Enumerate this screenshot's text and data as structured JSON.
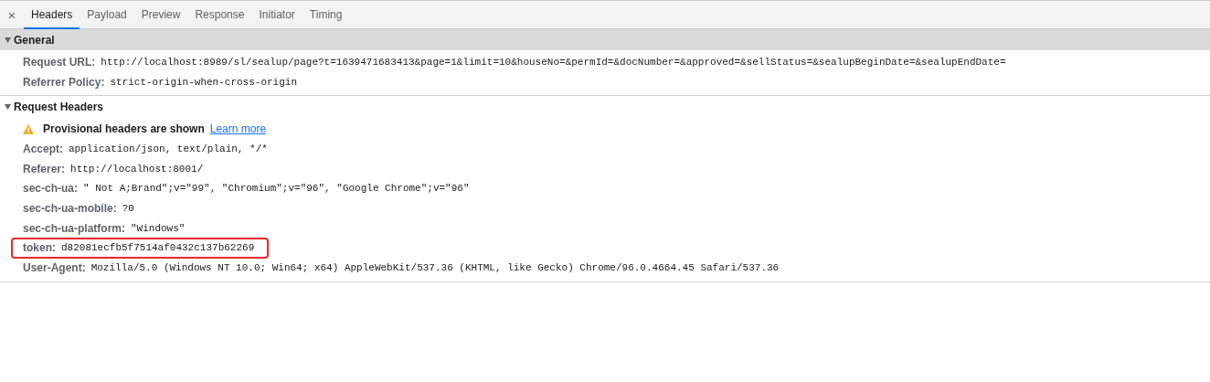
{
  "tabs": [
    {
      "label": "Headers",
      "selected": true
    },
    {
      "label": "Payload",
      "selected": false
    },
    {
      "label": "Preview",
      "selected": false
    },
    {
      "label": "Response",
      "selected": false
    },
    {
      "label": "Initiator",
      "selected": false
    },
    {
      "label": "Timing",
      "selected": false
    }
  ],
  "close": "×",
  "sections": [
    {
      "title": "General",
      "expanded": true,
      "shaded": true,
      "rows": [
        {
          "kind": "header",
          "name": "Request URL:",
          "value": "http://localhost:8989/sl/sealup/page?t=1639471683413&page=1&limit=10&houseNo=&permId=&docNumber=&approved=&sellStatus=&sealupBeginDate=&sealupEndDate=",
          "highlighted": false
        },
        {
          "kind": "header",
          "name": "Referrer Policy:",
          "value": "strict-origin-when-cross-origin",
          "highlighted": false
        }
      ]
    },
    {
      "title": "Request Headers",
      "expanded": true,
      "shaded": false,
      "rows": [
        {
          "kind": "warning",
          "text": "Provisional headers are shown",
          "link": "Learn more"
        },
        {
          "kind": "header",
          "name": "Accept:",
          "value": "application/json, text/plain, */*",
          "highlighted": false
        },
        {
          "kind": "header",
          "name": "Referer:",
          "value": "http://localhost:8001/",
          "highlighted": false
        },
        {
          "kind": "header",
          "name": "sec-ch-ua:",
          "value": "\" Not A;Brand\";v=\"99\", \"Chromium\";v=\"96\", \"Google Chrome\";v=\"96\"",
          "highlighted": false
        },
        {
          "kind": "header",
          "name": "sec-ch-ua-mobile:",
          "value": "?0",
          "highlighted": false
        },
        {
          "kind": "header",
          "name": "sec-ch-ua-platform:",
          "value": "\"Windows\"",
          "highlighted": false
        },
        {
          "kind": "header",
          "name": "token:",
          "value": "d82081ecfb5f7514af0432c137b62269",
          "highlighted": true
        },
        {
          "kind": "header",
          "name": "User-Agent:",
          "value": "Mozilla/5.0 (Windows NT 10.0; Win64; x64) AppleWebKit/537.36 (KHTML, like Gecko) Chrome/96.0.4664.45 Safari/537.36",
          "highlighted": false
        }
      ]
    }
  ]
}
